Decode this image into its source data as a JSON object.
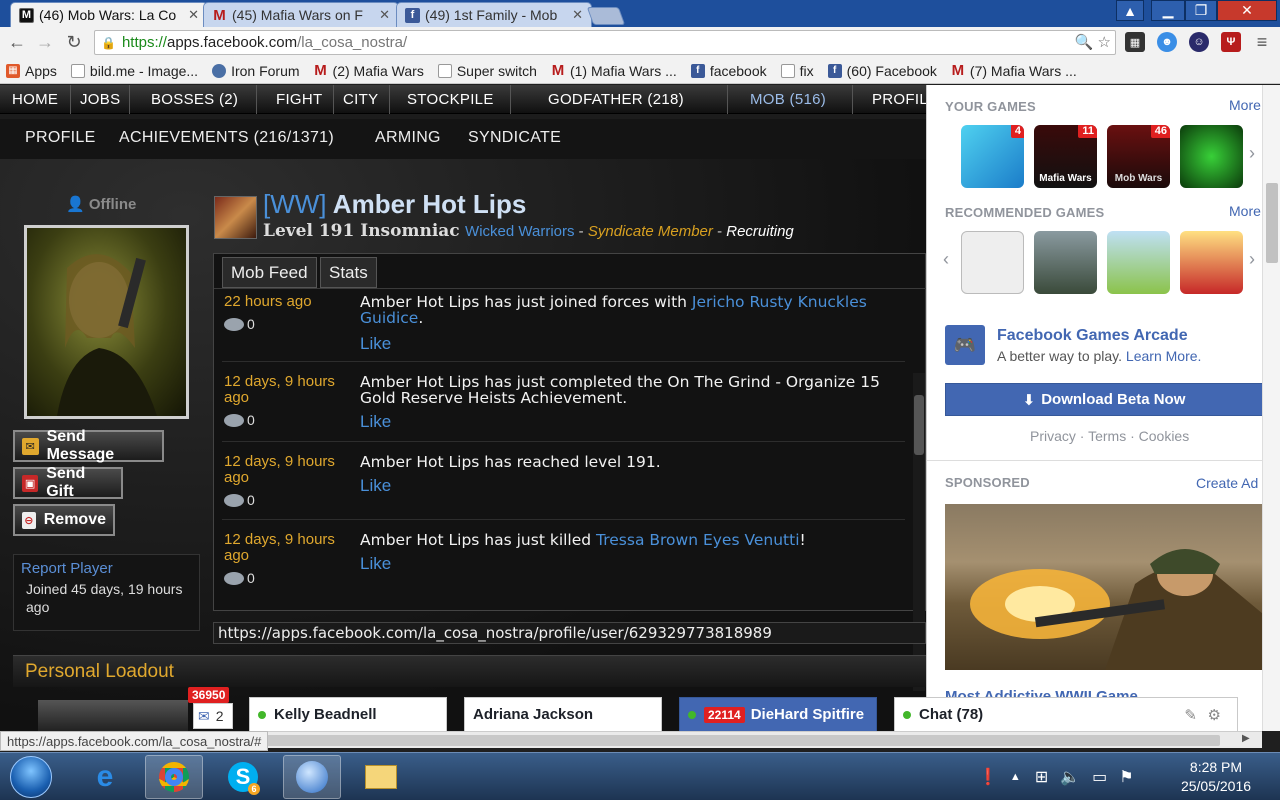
{
  "browser": {
    "tabs": [
      {
        "label": "(46) Mob Wars: La Co",
        "icon": "M",
        "color": "#111111",
        "active": true
      },
      {
        "label": "(45) Mafia Wars on F",
        "icon": "M",
        "color": "#b71c1c",
        "active": false
      },
      {
        "label": "(49) 1st Family - Mob",
        "icon": "f",
        "color": "#3b5998",
        "active": false
      }
    ],
    "url": {
      "scheme": "https://",
      "host": "apps.facebook.com",
      "path": "/la_cosa_nostra/"
    },
    "bookmarks": [
      {
        "label": "Apps",
        "icon": "grid-icon"
      },
      {
        "label": "bild.me - Image...",
        "icon": "page-icon"
      },
      {
        "label": "Iron Forum",
        "icon": "globe-icon"
      },
      {
        "label": "(2) Mafia Wars",
        "icon": "mafia-m-icon"
      },
      {
        "label": "Super switch",
        "icon": "page-icon"
      },
      {
        "label": "(1) Mafia Wars ...",
        "icon": "mafia-m-icon"
      },
      {
        "label": "facebook",
        "icon": "facebook-icon"
      },
      {
        "label": "fix",
        "icon": "page-icon"
      },
      {
        "label": "(60) Facebook",
        "icon": "facebook-icon"
      },
      {
        "label": "(7) Mafia Wars ...",
        "icon": "mafia-m-icon"
      }
    ]
  },
  "game": {
    "nav_primary": [
      "HOME",
      "JOBS",
      "BOSSES (2)",
      "FIGHT",
      "CITY",
      "STOCKPILE",
      "GODFATHER (218)",
      "MOB (516)",
      "PROFIL"
    ],
    "nav_secondary": [
      "PROFILE",
      "ACHIEVEMENTS (216/1371)",
      "ARMING",
      "SYNDICATE"
    ],
    "status": "Offline",
    "actions": {
      "send_message": "Send Message",
      "send_gift": "Send Gift",
      "remove": "Remove"
    },
    "report": {
      "link": "Report Player",
      "joined": "Joined 45 days, 19 hours ago"
    },
    "profile": {
      "tag": "[WW]",
      "name": "Amber Hot Lips",
      "level": "Level 191 Insomniac",
      "family": "Wicked Warriors",
      "sep1": " - ",
      "role": "Syndicate Member",
      "sep2": " - ",
      "recruit": "Recruiting"
    },
    "feed_tabs": [
      "Mob Feed",
      "Stats"
    ],
    "feed": [
      {
        "time": "22 hours ago",
        "comments": "0",
        "text": "Amber Hot Lips has just joined forces with ",
        "link": "Jericho Rusty Knuckles Guidice",
        "after": ".",
        "like": "Like"
      },
      {
        "time": "12 days, 9 hours ago",
        "comments": "0",
        "text": "Amber Hot Lips has just completed the On The Grind - Organize 15 Gold Reserve Heists Achievement.",
        "link": "",
        "after": "",
        "like": "Like"
      },
      {
        "time": "12 days, 9 hours ago",
        "comments": "0",
        "text": "Amber Hot Lips has reached level 191.",
        "link": "",
        "after": "",
        "like": "Like"
      },
      {
        "time": "12 days, 9 hours ago",
        "comments": "0",
        "text": "Amber Hot Lips has just killed ",
        "link": "Tressa Brown Eyes Venutti",
        "after": "!",
        "like": "Like"
      }
    ],
    "hover_url": "https://apps.facebook.com/la_cosa_nostra/profile/user/629329773818989",
    "loadout_title": "Personal Loadout"
  },
  "facebook": {
    "your_games": "YOUR GAMES",
    "recommended": "RECOMMENDED GAMES",
    "more": "More",
    "game_badges": [
      "4",
      "11",
      "46"
    ],
    "game_tile_text": [
      "Mafia Wars",
      "Mob Wars"
    ],
    "arcade_title": "Facebook Games Arcade",
    "arcade_sub": "A better way to play.",
    "arcade_learn": "Learn More.",
    "download": "Download Beta Now",
    "links": "Privacy · Terms · Cookies",
    "sponsored": "SPONSORED",
    "create_ad": "Create Ad",
    "ad_title": "Most Addictive WWII Game"
  },
  "chat": {
    "notif_count": "36950",
    "small_count": "2",
    "boxes": [
      "Kelly Beadnell",
      "Adriana Jackson",
      "DieHard Spitfire"
    ],
    "diehard_count": "22114",
    "chat_label": "Chat (78)"
  },
  "statusbar": "https://apps.facebook.com/la_cosa_nostra/#",
  "taskbar": {
    "time": "8:28 PM",
    "date": "25/05/2016",
    "skype_badge": "6"
  }
}
